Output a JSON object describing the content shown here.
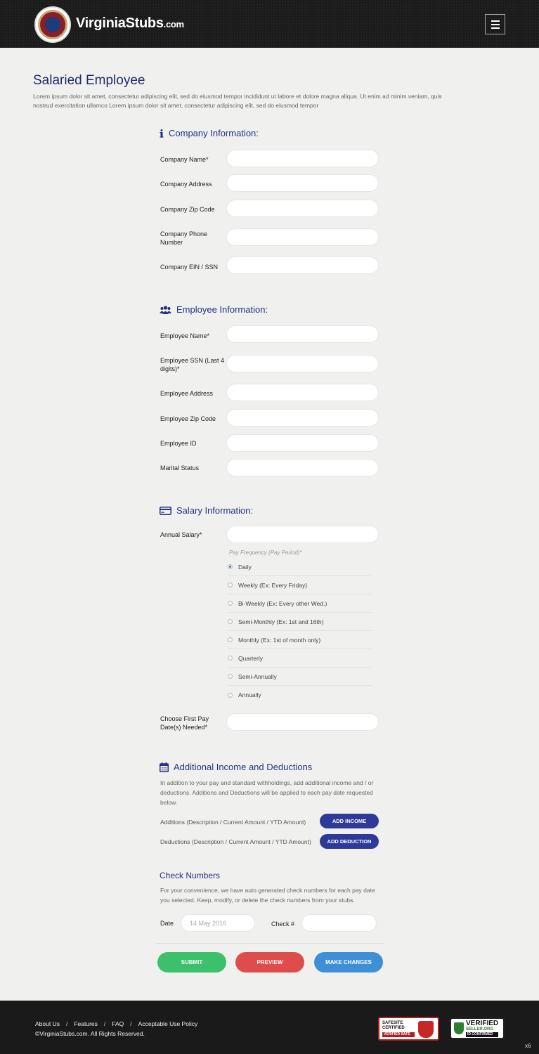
{
  "header": {
    "brand": "VirginiaStubs",
    "brand_suffix": ".com"
  },
  "page": {
    "title": "Salaried Employee",
    "intro": "Lorem ipsum dolor sit amet, consectetur adipiscing elit, sed do eiusmod tempor incididunt ut labore et dolore magna aliqua. Ut enim ad minim veniam, quis nostrud exercitation ullamco Lorem ipsum dolor sit amet, consectetur adipiscing elit, sed do eiusmod tempor"
  },
  "company": {
    "heading": "Company Information:",
    "fields": [
      {
        "label": "Company Name*",
        "value": ""
      },
      {
        "label": "Company Address",
        "value": ""
      },
      {
        "label": "Company Zip Code",
        "value": ""
      },
      {
        "label": "Company Phone Number",
        "value": ""
      },
      {
        "label": "Company EIN / SSN",
        "value": ""
      }
    ]
  },
  "employee": {
    "heading": "Employee Information:",
    "fields": [
      {
        "label": "Employee Name*",
        "value": ""
      },
      {
        "label": "Employee SSN (Last 4 digits)*",
        "value": ""
      },
      {
        "label": "Employee Address",
        "value": ""
      },
      {
        "label": "Employee Zip Code",
        "value": ""
      },
      {
        "label": "Employee ID",
        "value": ""
      },
      {
        "label": "Marital Status",
        "value": ""
      }
    ]
  },
  "salary": {
    "heading": "Salary Information:",
    "annual_label": "Annual Salary*",
    "annual_value": "",
    "pay_frequency_label": "Pay Frequency (Pay Period)*",
    "pay_frequency_options": [
      "Daily",
      "Weekly (Ex: Every Friday)",
      "Bi-Weekly (Ex: Every other Wed.)",
      "Semi-Monthly (Ex: 1st and 16th)",
      "Monthly (Ex: 1st of month only)",
      "Quarterly",
      "Semi-Annually",
      "Annually"
    ],
    "selected_frequency": "Daily",
    "first_pay_label": "Choose First Pay Date(s) Needed*",
    "first_pay_value": ""
  },
  "additional": {
    "heading": "Additional Income and Deductions",
    "description": "In addition to your pay and standard withholdings, add additional income and / or deductions. Additions and Deductions will be applied to each pay date requested below.",
    "additions_label": "Additions (Description / Current Amount / YTD Amount)",
    "add_income_button": "ADD INCOME",
    "deductions_label": "Deductions (Description / Current Amount / YTD Amount)",
    "add_deduction_button": "ADD DEDUCTION"
  },
  "checks": {
    "heading": "Check Numbers",
    "description": "For your convenience, we have auto generated check numbers for each pay date you selected. Keep, modify, or delete the check numbers from your stubs.",
    "date_label": "Date",
    "date_value": "14 May 2016",
    "check_label": "Check #",
    "check_value": ""
  },
  "actions": {
    "submit": "SUBMIT",
    "preview": "PREVIEW",
    "make_changes": "MAKE CHANGES"
  },
  "footer": {
    "links": [
      "About Us",
      "Features",
      "FAQ",
      "Acceptable Use Policy"
    ],
    "copyright": "©VirginiaStubs.com. All Rights Reserved.",
    "badge_safe_line1": "SAFESITE",
    "badge_safe_line2": "CERTIFIED",
    "badge_safe_sub": "VERIFIED SAFE",
    "badge_verified_line1": "VERIFIED",
    "badge_verified_line2": "SELLER.ORG",
    "badge_verified_sub": "ID CONFIRMED",
    "scale_note": "x6"
  },
  "colors": {
    "accent": "#243285",
    "submit": "#3cc06b",
    "preview": "#de4c4c",
    "make_changes": "#3f8fd6",
    "pill": "#2e3a9a"
  }
}
